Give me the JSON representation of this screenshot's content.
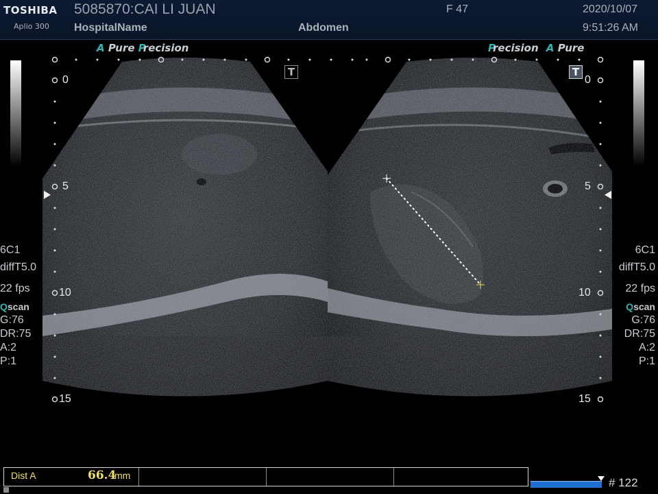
{
  "header": {
    "brand": "TOSHIBA",
    "model": "Aplio 300",
    "patient": "5085870:CAI LI JUAN",
    "hospital": "HospitalName",
    "exam": "Abdomen",
    "sex_age": "F  47",
    "date": "2020/10/07",
    "time": "9:51:26 AM"
  },
  "left_image": {
    "tech_a": "A",
    "tech_pure": "Pure",
    "tech_p": "P",
    "tech_recision": "recision",
    "depth_labels": [
      "0",
      "5",
      "10",
      "15"
    ],
    "t_button": "T"
  },
  "right_image": {
    "tech_p": "P",
    "tech_recision": "recision",
    "tech_a": "A",
    "tech_pure": "Pure",
    "depth_labels": [
      "0",
      "5",
      "10",
      "15"
    ],
    "t_button": "T"
  },
  "params": {
    "probe": "6C1",
    "freq": "diffT5.0",
    "fps": "22 fps",
    "qscan_q": "Q",
    "qscan_rest": "scan",
    "gain": "G:76",
    "dr": "DR:75",
    "a": "A:2",
    "p": "P:1"
  },
  "measurement": {
    "label": "Dist A",
    "value": "66.4",
    "unit": "mm"
  },
  "cine": {
    "frame": "# 122"
  },
  "colors": {
    "header_bg": "#0c1a33",
    "accent_teal": "#2fb5b5",
    "measure_yellow": "#f0e060",
    "cine_blue": "#1f6fd0"
  }
}
